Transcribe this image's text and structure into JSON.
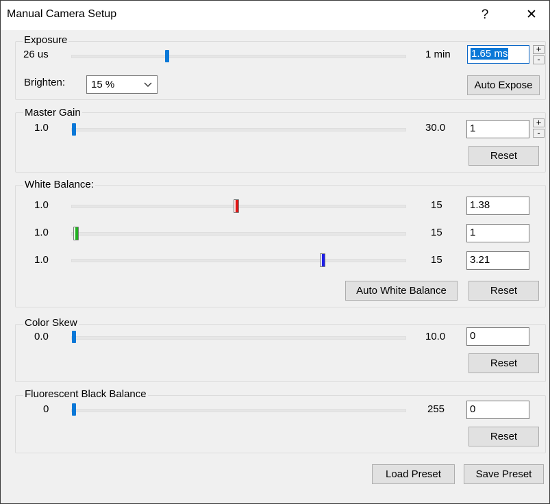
{
  "window": {
    "title": "Manual Camera Setup",
    "help_glyph": "?",
    "close_glyph": "✕"
  },
  "exposure": {
    "legend": "Exposure",
    "min": "26 us",
    "max": "1 min",
    "value": "1.65 ms",
    "slider_fraction": 0.28,
    "brighten_label": "Brighten:",
    "brighten_value": "15 %",
    "auto_button": "Auto Expose"
  },
  "spin": {
    "up": "+",
    "down": "-"
  },
  "master_gain": {
    "legend": "Master Gain",
    "min": "1.0",
    "max": "30.0",
    "value": "1",
    "slider_fraction": 0.0,
    "reset": "Reset"
  },
  "white_balance": {
    "legend": "White Balance:",
    "channels": [
      {
        "name": "red",
        "min": "1.0",
        "max": "15",
        "value": "1.38",
        "slider_fraction": 0.49
      },
      {
        "name": "green",
        "min": "1.0",
        "max": "15",
        "value": "1",
        "slider_fraction": 0.0
      },
      {
        "name": "blue",
        "min": "1.0",
        "max": "15",
        "value": "3.21",
        "slider_fraction": 0.75
      }
    ],
    "auto_button": "Auto White Balance",
    "reset": "Reset"
  },
  "color_skew": {
    "legend": "Color Skew",
    "min": "0.0",
    "max": "10.0",
    "value": "0",
    "slider_fraction": 0.0,
    "reset": "Reset"
  },
  "fluorescent": {
    "legend": "Fluorescent Black Balance",
    "min": "0",
    "max": "255",
    "value": "0",
    "slider_fraction": 0.0,
    "reset": "Reset"
  },
  "footer": {
    "load": "Load Preset",
    "save": "Save Preset"
  },
  "colors": {
    "accent": "#0078d7",
    "red": "#e01515",
    "green": "#22b022",
    "blue": "#1e1ee8"
  }
}
